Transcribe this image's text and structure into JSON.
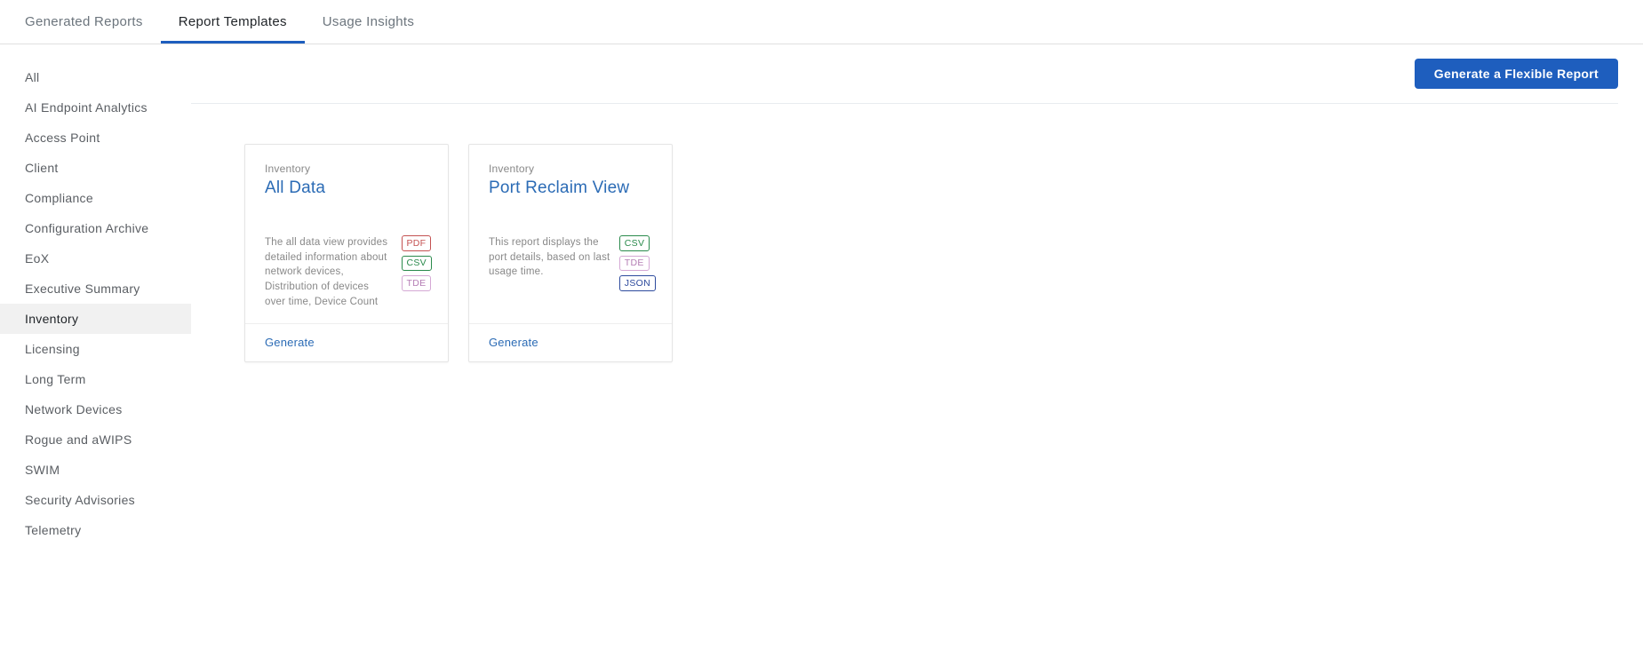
{
  "tabs": [
    {
      "label": "Generated Reports",
      "active": false
    },
    {
      "label": "Report Templates",
      "active": true
    },
    {
      "label": "Usage Insights",
      "active": false
    }
  ],
  "sidebar": {
    "items": [
      {
        "label": "All",
        "selected": false
      },
      {
        "label": "AI Endpoint Analytics",
        "selected": false
      },
      {
        "label": "Access Point",
        "selected": false
      },
      {
        "label": "Client",
        "selected": false
      },
      {
        "label": "Compliance",
        "selected": false
      },
      {
        "label": "Configuration Archive",
        "selected": false
      },
      {
        "label": "EoX",
        "selected": false
      },
      {
        "label": "Executive Summary",
        "selected": false
      },
      {
        "label": "Inventory",
        "selected": true
      },
      {
        "label": "Licensing",
        "selected": false
      },
      {
        "label": "Long Term",
        "selected": false
      },
      {
        "label": "Network Devices",
        "selected": false
      },
      {
        "label": "Rogue and aWIPS",
        "selected": false
      },
      {
        "label": "SWIM",
        "selected": false
      },
      {
        "label": "Security Advisories",
        "selected": false
      },
      {
        "label": "Telemetry",
        "selected": false
      }
    ]
  },
  "header": {
    "primary_button": "Generate a Flexible Report"
  },
  "cards": [
    {
      "eyebrow": "Inventory",
      "title": "All Data",
      "description": "The all data view provides detailed information about network devices, Distribution of devices over time, Device Count",
      "formats": [
        "PDF",
        "CSV",
        "TDE"
      ],
      "action": "Generate"
    },
    {
      "eyebrow": "Inventory",
      "title": "Port Reclaim View",
      "description": "This report displays the port details, based on last usage time.",
      "formats": [
        "CSV",
        "TDE",
        "JSON"
      ],
      "action": "Generate"
    }
  ]
}
